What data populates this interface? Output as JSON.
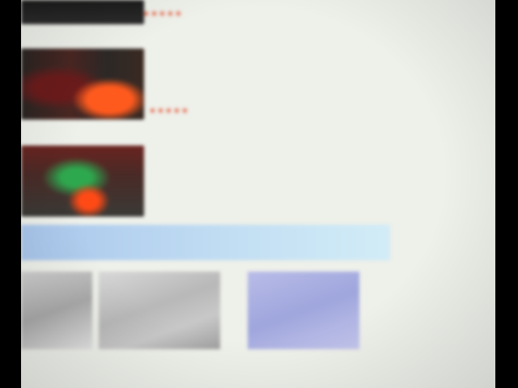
{
  "results": [
    {
      "title_line1": "",
      "title_line2": "",
      "meta_lines": [],
      "rating": "★★★★★"
    },
    {
      "title_line1": "",
      "title_line2": "",
      "meta_lines": [],
      "rating": "★★★★★"
    },
    {
      "title_line1": "",
      "title_line2": "",
      "meta_lines": [],
      "rating": ""
    }
  ],
  "section": {
    "label": ""
  },
  "sidebar": {
    "title": "",
    "lines": [
      "",
      "",
      "",
      ""
    ]
  },
  "tiles": [
    {
      "caption": ""
    },
    {
      "caption": ""
    },
    {
      "caption": ""
    }
  ],
  "colors": {
    "link": "#2a3cd8",
    "rating": "#e55a3a",
    "section_bar": "#a9c6ec",
    "sidebar_title": "#f2842a",
    "page_background": "#eef0ea"
  }
}
